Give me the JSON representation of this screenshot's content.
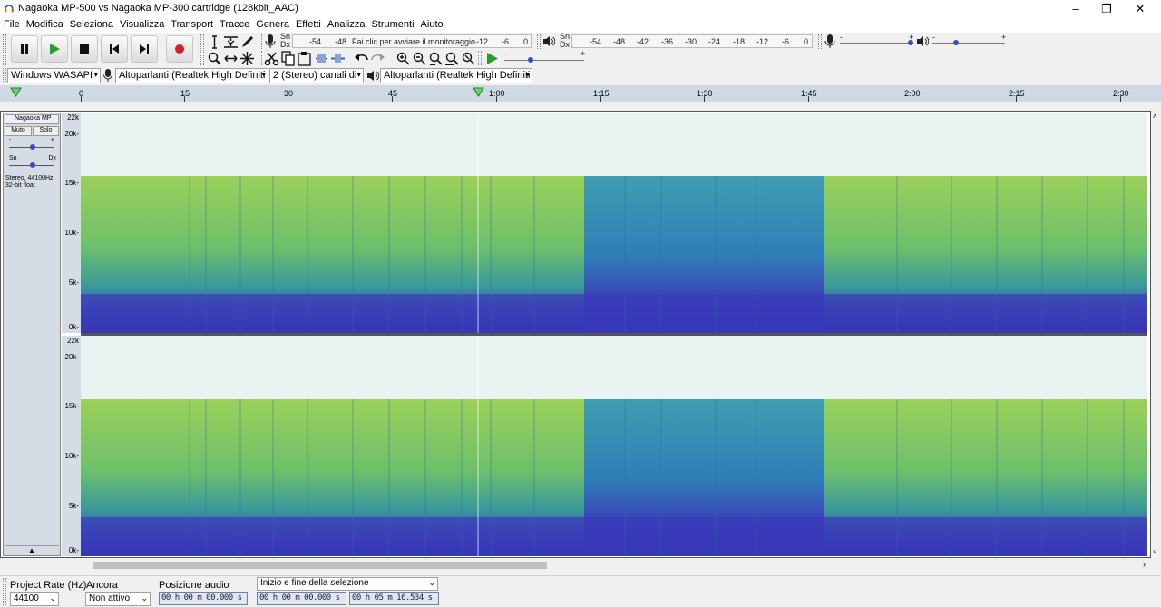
{
  "window": {
    "title": "Nagaoka MP-500 vs Nagaoka MP-300 cartridge (128kbit_AAC)",
    "minimize": "–",
    "maximize": "❐",
    "close": "✕"
  },
  "menu": [
    "File",
    "Modifica",
    "Seleziona",
    "Visualizza",
    "Transport",
    "Tracce",
    "Genera",
    "Effetti",
    "Analizza",
    "Strumenti",
    "Aiuto"
  ],
  "transport": {
    "pause": "pause-icon",
    "play": "play-icon",
    "stop": "stop-icon",
    "skip_start": "skip-start-icon",
    "skip_end": "skip-end-icon",
    "record": "record-icon"
  },
  "record_meter": {
    "lr": [
      "Sn",
      "Dx"
    ],
    "scale": [
      "-54",
      "-48"
    ],
    "prompt": "Fai clic per avviare il monitoraggio",
    "scale2": [
      "-12",
      "-6",
      "0"
    ]
  },
  "play_meter": {
    "lr": [
      "Sn",
      "Dx"
    ],
    "scale": [
      "-54",
      "-48",
      "-42",
      "-36",
      "-30",
      "-24",
      "-18",
      "-12",
      "-6",
      "0"
    ]
  },
  "mixer": {
    "rec_scale_min": "-",
    "rec_scale_max": "+",
    "play_scale_min": "-",
    "play_scale_max": "+"
  },
  "device": {
    "host": "Windows WASAPI",
    "input": "Altoparlanti (Realtek High Definiti",
    "channels": "2 (Stereo) canali di",
    "output": "Altoparlanti (Realtek High Definiti"
  },
  "ruler": {
    "ticks": [
      "0",
      "15",
      "30",
      "45",
      "1:00",
      "1:15",
      "1:30",
      "1:45",
      "2:00",
      "2:15",
      "2:30"
    ]
  },
  "track": {
    "name": "Nagaoka MP",
    "close": "✕",
    "mute": "Muto",
    "solo": "Solo",
    "gain_min": "-",
    "gain_max": "+",
    "pan_left": "Sn",
    "pan_right": "Dx",
    "info_line1": "Stereo, 44100Hz",
    "info_line2": "32-bit float",
    "collapse": "▲",
    "freq_labels": [
      "22k",
      "20k-",
      "15k-",
      "10k-",
      "5k-",
      "0k-"
    ]
  },
  "selection_bar": {
    "rate_label": "Project Rate (Hz)",
    "rate_value": "44100",
    "snap_label": "Ancora",
    "snap_value": "Non attivo",
    "pos_label": "Posizione audio",
    "pos_value": "00 h 00 m 00.000 s",
    "sel_label": "Inizio e fine della selezione",
    "sel_start": "00 h 00 m 00.000 s",
    "sel_end": "00 h 05 m 16.534 s"
  }
}
